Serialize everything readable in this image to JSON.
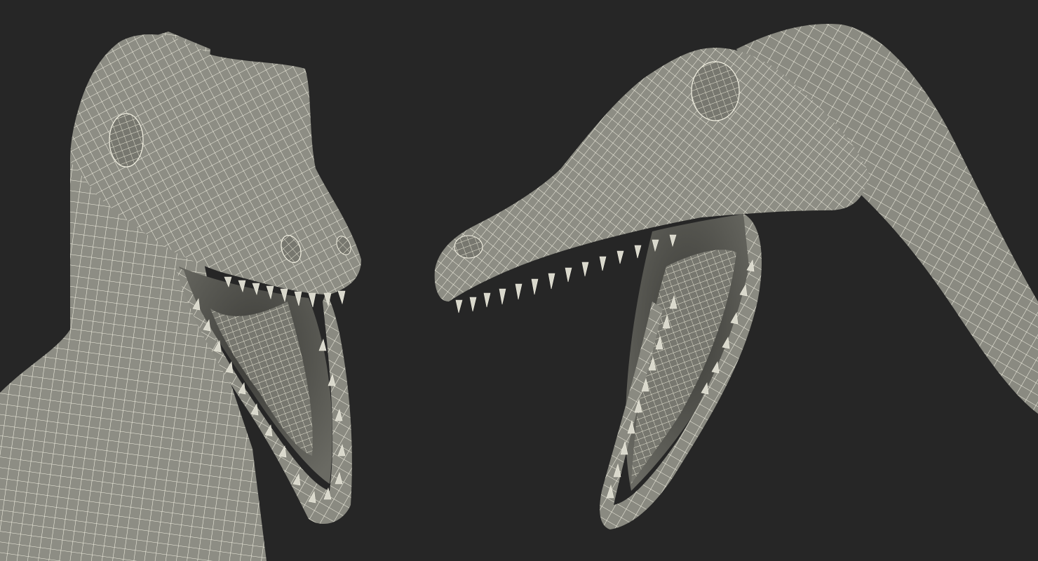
{
  "scene": {
    "background_color": "#262626",
    "mesh_color": "#8d8d84",
    "mesh_shadow_color": "#6f6f67",
    "mouth_interior_color": "#55554f",
    "wire_color": "#f4f2e4",
    "views": [
      {
        "name": "front-three-quarter-view",
        "subject": "dinosaur-head-wireframe",
        "mouth": "open"
      },
      {
        "name": "side-view",
        "subject": "dinosaur-head-wireframe",
        "mouth": "open"
      }
    ]
  }
}
